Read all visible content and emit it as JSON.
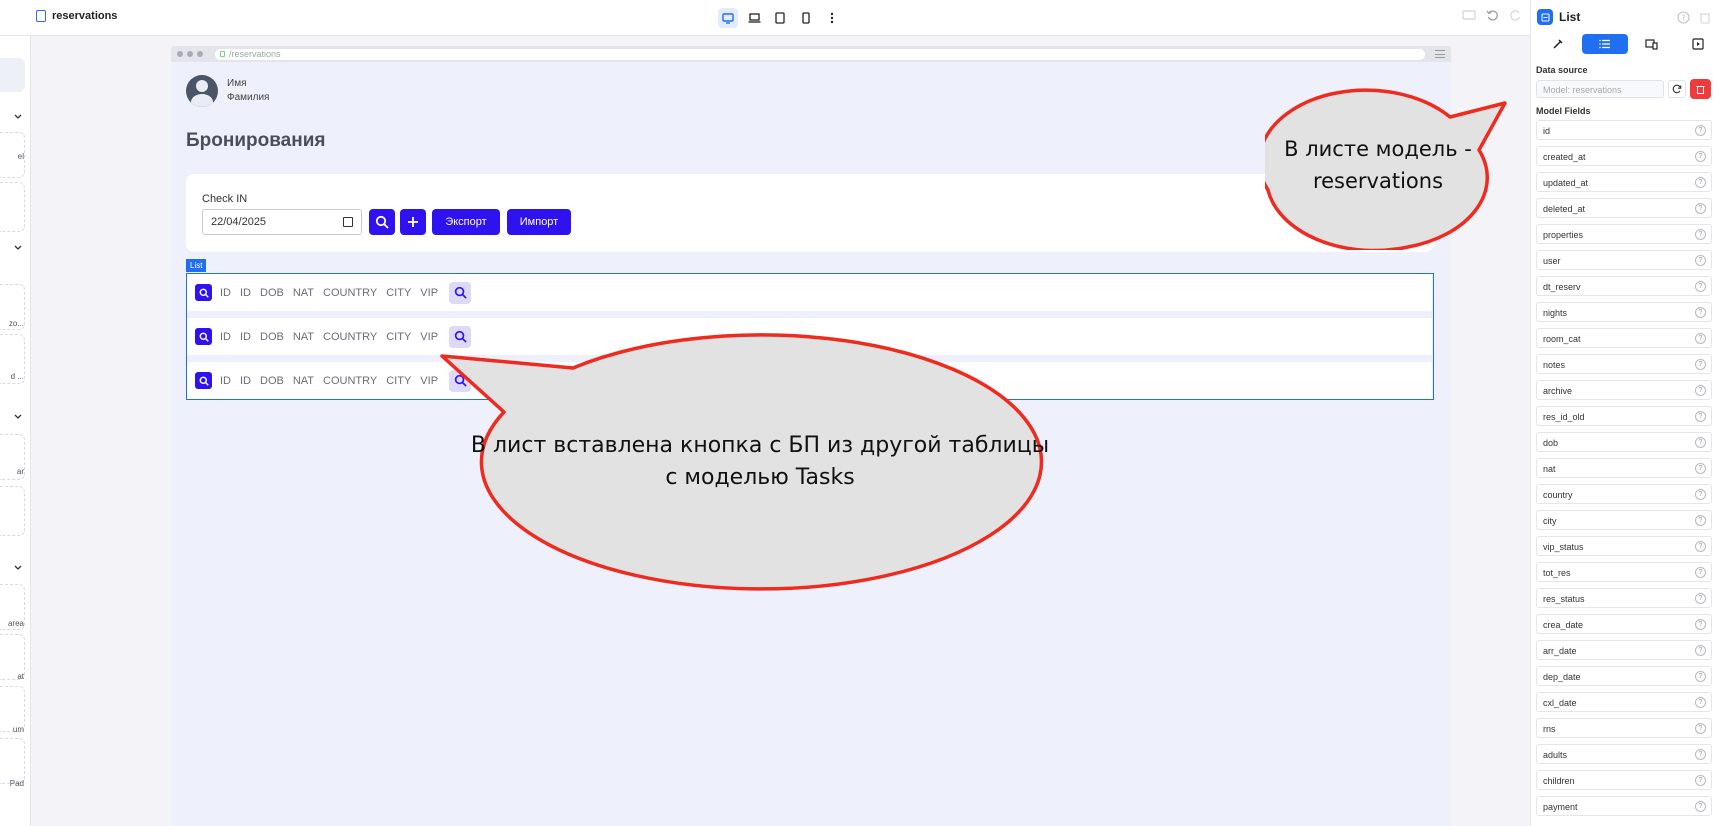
{
  "topbar": {
    "page_name": "reservations"
  },
  "left_panel": {
    "fragments": [
      "el",
      "zo...",
      "d ...",
      "ar",
      "area",
      "at",
      "um",
      "Pad"
    ]
  },
  "frame": {
    "url": "/reservations",
    "user": {
      "name": "Имя",
      "surname": "Фамилия"
    },
    "page_title": "Бронирования",
    "filter": {
      "label": "Check IN",
      "date_value": "22/04/2025",
      "export_label": "Экспорт",
      "import_label": "Импорт"
    },
    "list_tag": "List",
    "row_columns": [
      "ID",
      "ID",
      "DOB",
      "NAT",
      "COUNTRY",
      "CITY",
      "VIP"
    ]
  },
  "right_panel": {
    "title": "List",
    "data_source_label": "Data source",
    "data_source_placeholder": "Model: reservations",
    "model_fields_label": "Model Fields",
    "fields": [
      "id",
      "created_at",
      "updated_at",
      "deleted_at",
      "properties",
      "user",
      "dt_reserv",
      "nights",
      "room_cat",
      "notes",
      "archive",
      "res_id_old",
      "dob",
      "nat",
      "country",
      "city",
      "vip_status",
      "tot_res",
      "res_status",
      "crea_date",
      "arr_date",
      "dep_date",
      "cxl_date",
      "rns",
      "adults",
      "children",
      "payment"
    ]
  },
  "annotations": {
    "top_right": {
      "line1": "В листе модель -",
      "line2": "reservations"
    },
    "center": {
      "line1": "В лист вставлена кнопка с БП из другой таблицы",
      "line2": "с моделью Tasks"
    }
  },
  "colors": {
    "accent": "#2e12f0",
    "selection": "#1f6ff0",
    "danger": "#ef3b3b",
    "callout_stroke": "#ef2a1f",
    "callout_fill": "#e2e2e2"
  }
}
